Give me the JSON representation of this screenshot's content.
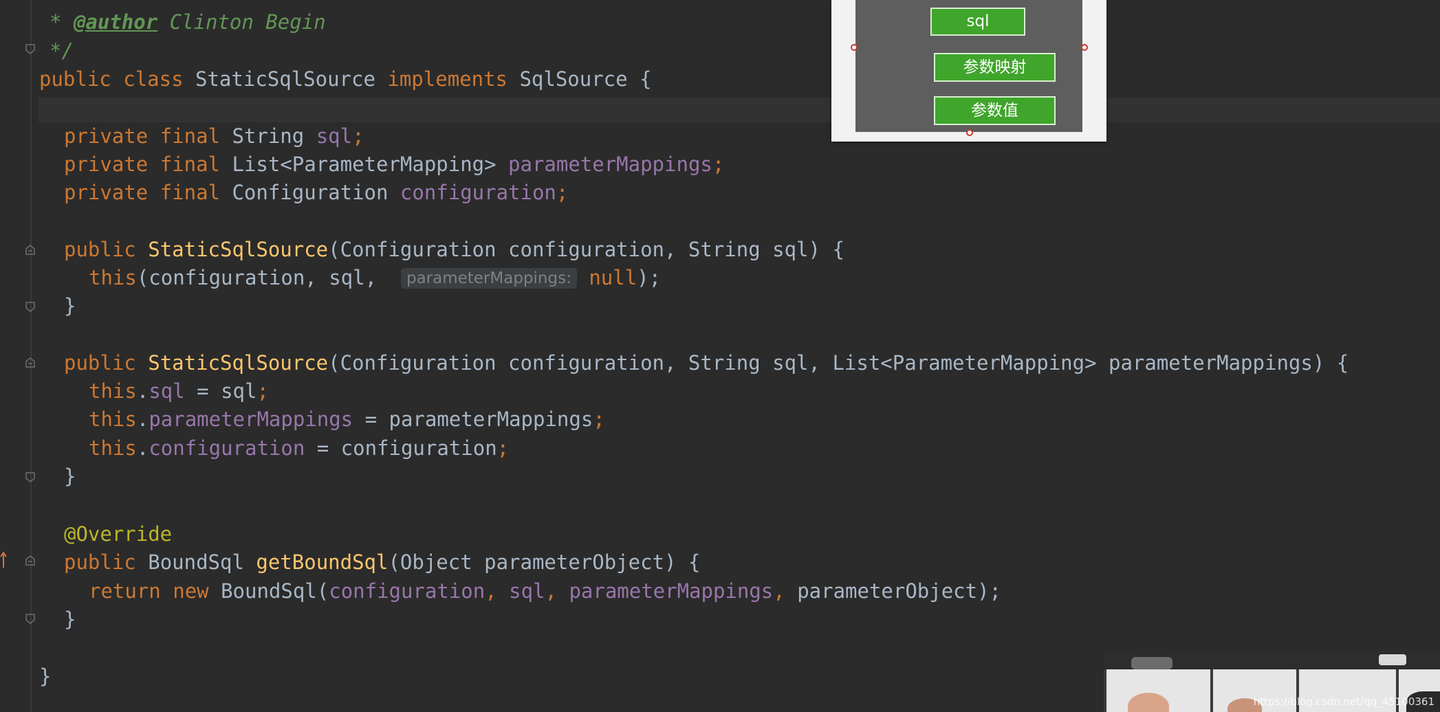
{
  "editor": {
    "lines": {
      "l1": {
        "star": "*",
        "tag": "@author",
        "name": "Clinton Begin"
      },
      "l2": {
        "text": "*/"
      },
      "l3": {
        "kw1": "public",
        "kw2": "class",
        "cls": "StaticSqlSource",
        "kw3": "implements",
        "iface": "SqlSource",
        "brace": "{"
      },
      "l5": {
        "kw1": "private",
        "kw2": "final",
        "type": "String",
        "field": "sql",
        "semi": ";"
      },
      "l6": {
        "kw1": "private",
        "kw2": "final",
        "type": "List<ParameterMapping>",
        "field": "parameterMappings",
        "semi": ";"
      },
      "l7": {
        "kw1": "private",
        "kw2": "final",
        "type": "Configuration",
        "field": "configuration",
        "semi": ";"
      },
      "l9": {
        "kw1": "public",
        "name": "StaticSqlSource",
        "params": "(Configuration configuration, String sql)",
        "brace": "{"
      },
      "l10": {
        "kw": "this",
        "args": "(configuration, sql, ",
        "hint": "parameterMappings:",
        "nul": "null",
        "end": ");"
      },
      "l11": {
        "text": "}"
      },
      "l13": {
        "kw1": "public",
        "name": "StaticSqlSource",
        "params": "(Configuration configuration, String sql, List<ParameterMapping> parameterMappings)",
        "brace": "{"
      },
      "l14": {
        "kw": "this",
        "dot": ".",
        "field": "sql",
        "rest": " = sql",
        "semi": ";"
      },
      "l15": {
        "kw": "this",
        "dot": ".",
        "field": "parameterMappings",
        "rest": " = parameterMappings",
        "semi": ";"
      },
      "l16": {
        "kw": "this",
        "dot": ".",
        "field": "configuration",
        "rest": " = configuration",
        "semi": ";"
      },
      "l17": {
        "text": "}"
      },
      "l19": {
        "ann": "@Override"
      },
      "l20": {
        "kw1": "public",
        "type": "BoundSql",
        "name": "getBoundSql",
        "params": "(Object parameterObject)",
        "brace": "{"
      },
      "l21": {
        "kw1": "return",
        "kw2": "new",
        "type": "BoundSql(",
        "f1": "configuration",
        "c1": ", ",
        "f2": "sql",
        "c2": ", ",
        "f3": "parameterMappings",
        "c3": ", ",
        "p": "parameterObject",
        "end": ");"
      },
      "l22": {
        "text": "}"
      },
      "l24": {
        "text": "}"
      }
    }
  },
  "popup": {
    "buttons": [
      "sql",
      "参数映射",
      "参数值"
    ]
  },
  "webcam": {
    "watermark": "https://blog.csdn.net/qq_45100361"
  }
}
